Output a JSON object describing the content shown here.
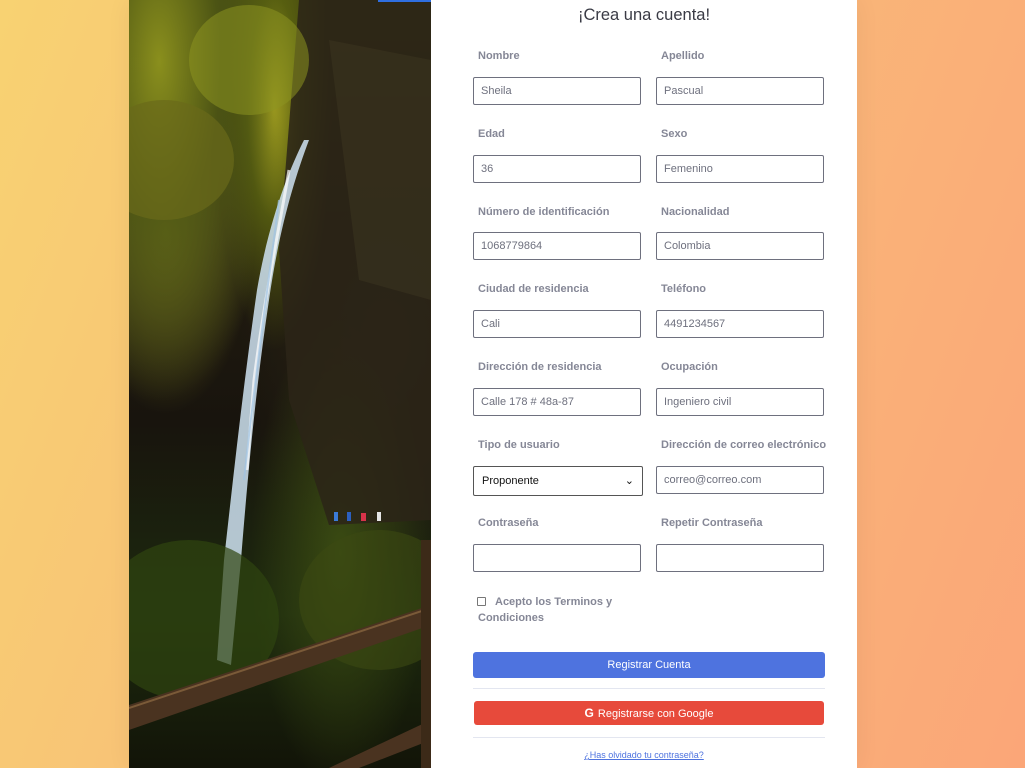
{
  "title": "¡Crea una cuenta!",
  "fields": [
    {
      "label": "Nombre",
      "value": "Sheila"
    },
    {
      "label": "Apellido",
      "value": "Pascual"
    },
    {
      "label": "Edad",
      "value": "36"
    },
    {
      "label": "Sexo",
      "value": "Femenino"
    },
    {
      "label": "Número de identificación",
      "value": "1068779864"
    },
    {
      "label": "Nacionalidad",
      "value": "Colombia"
    },
    {
      "label": "Ciudad de residencia",
      "value": "Cali"
    },
    {
      "label": "Teléfono",
      "value": "4491234567"
    },
    {
      "label": "Dirección de residencia",
      "value": "Calle 178 # 48a-87"
    },
    {
      "label": "Ocupación",
      "value": "Ingeniero civil"
    },
    {
      "label": "Tipo de usuario",
      "value": "Proponente"
    },
    {
      "label": "Dirección de correo electrónico",
      "value": "correo@correo.com"
    },
    {
      "label": "Contraseña",
      "value": ""
    },
    {
      "label": "Repetir Contraseña",
      "value": ""
    }
  ],
  "terms_label": "Acepto los Terminos y Condiciones",
  "register_button": "Registrar Cuenta",
  "google_button": "Registrarse con Google",
  "google_icon_glyph": "G",
  "forgot_link": "¿Has olvidado tu contraseña?",
  "select_chevron": "⌄",
  "colors": {
    "primary": "#4e73df",
    "google": "#e74a3b",
    "label": "#858796",
    "title": "#3a3b45"
  }
}
